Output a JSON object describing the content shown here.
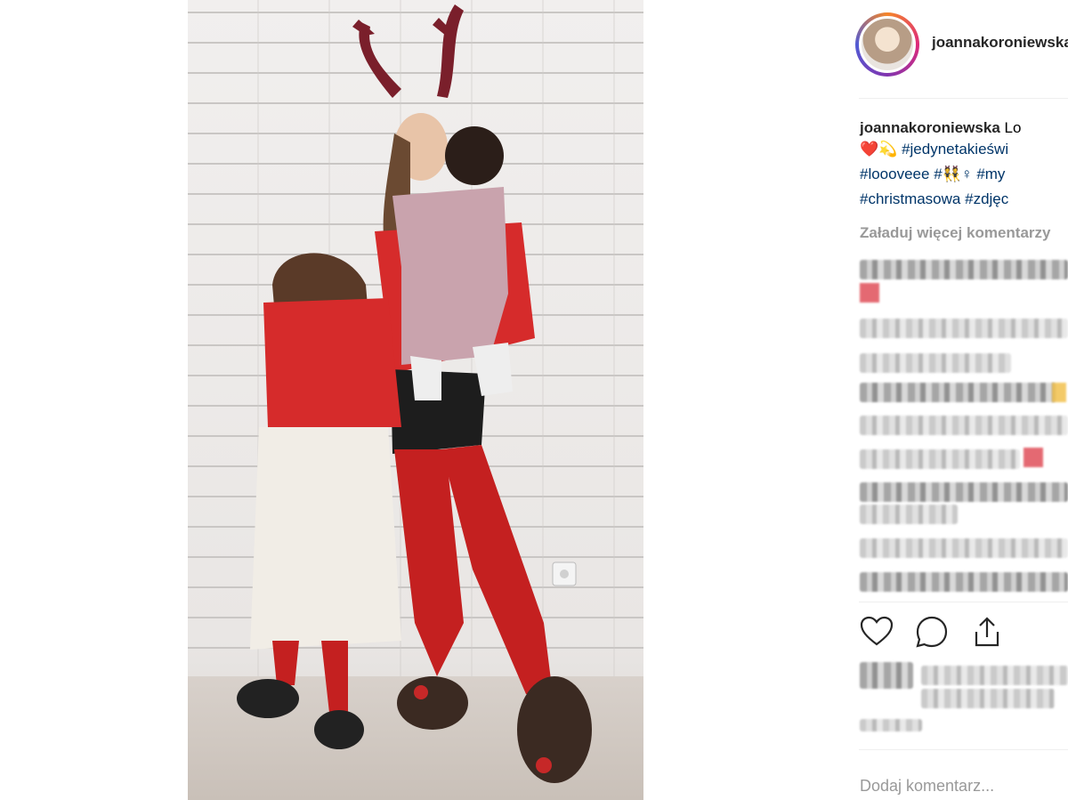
{
  "post": {
    "username": "joannakoroniewska",
    "caption_lines": [
      {
        "user": "joannakoroniewska",
        "text": "Lo"
      },
      {
        "emojis": "❤️💫",
        "tag": "#jedynetakieświ"
      },
      {
        "tag1": "#loooveee",
        "emoji": "#👯♀",
        "tag2": "#my"
      },
      {
        "tag1": "#christmasowa",
        "tag2": "#zdjęc"
      }
    ],
    "load_more": "Załaduj więcej komentarzy",
    "add_comment_placeholder": "Dodaj komentarz..."
  },
  "icons": {
    "like": "heart-icon",
    "comment": "comment-icon",
    "share": "share-icon"
  },
  "colors": {
    "tag": "#003569",
    "muted": "#999999",
    "text": "#262626"
  }
}
